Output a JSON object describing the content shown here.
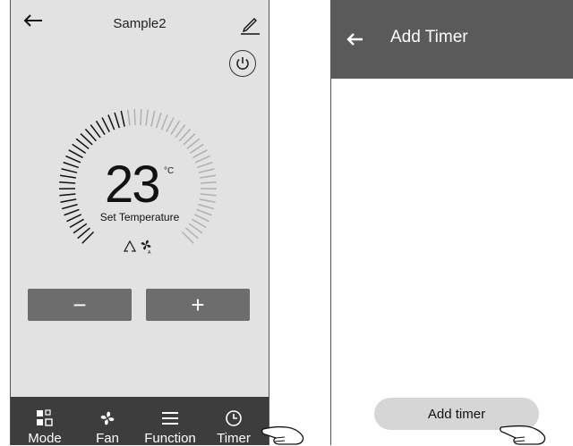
{
  "left_screen": {
    "title": "Sample2",
    "temperature": {
      "value": "23",
      "unit": "°C",
      "caption": "Set Temperature"
    },
    "controls": {
      "decrease_label": "−",
      "increase_label": "+"
    },
    "bottom_nav": [
      {
        "label": "Mode",
        "icon": "mode-icon"
      },
      {
        "label": "Fan",
        "icon": "fan-icon"
      },
      {
        "label": "Function",
        "icon": "menu-icon"
      },
      {
        "label": "Timer",
        "icon": "clock-icon"
      }
    ]
  },
  "right_screen": {
    "title": "Add Timer",
    "add_button_label": "Add timer"
  }
}
